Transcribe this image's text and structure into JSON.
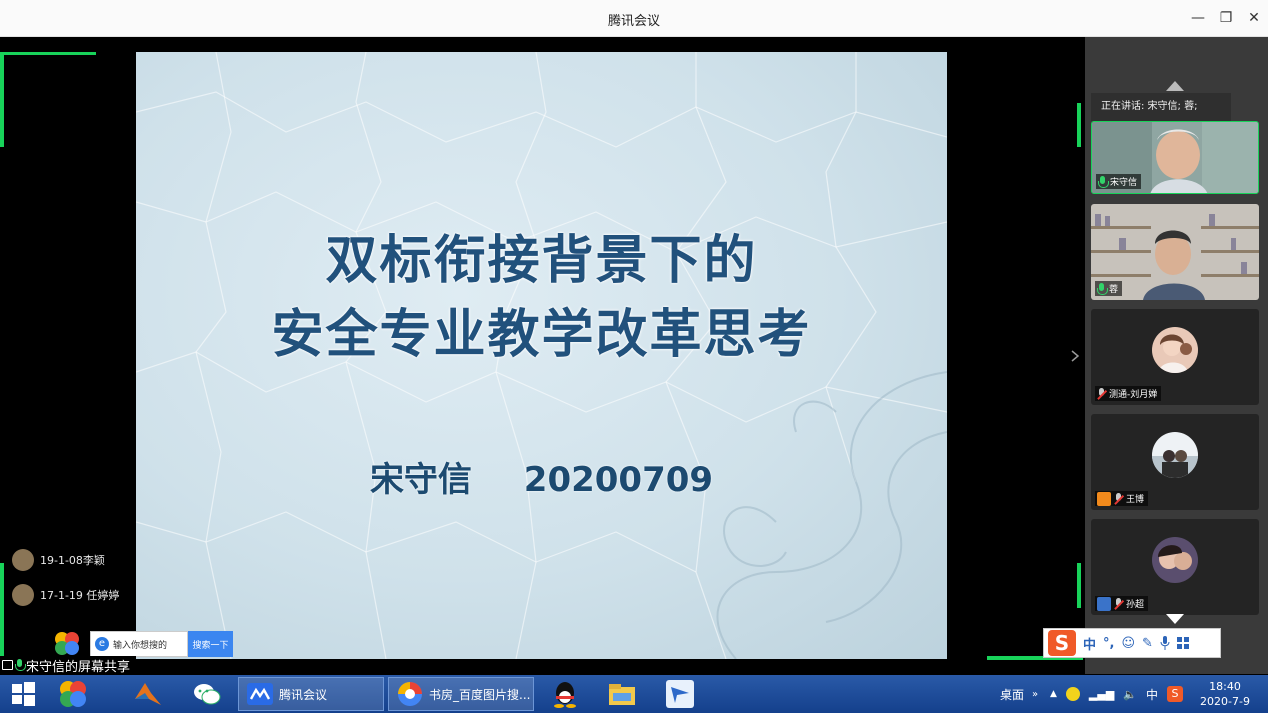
{
  "window": {
    "title": "腾讯会议",
    "minimize_icon": "minimize-icon",
    "restore_icon": "restore-icon",
    "close_icon": "close-icon"
  },
  "slide": {
    "title_line1": "双标衔接背景下的",
    "title_line2": "安全专业教学改革思考",
    "author": "宋守信",
    "date": "20200709"
  },
  "chat": [
    {
      "text": "19-1-08李颖"
    },
    {
      "text": "17-1-19 任婷婷"
    }
  ],
  "search": {
    "placeholder": "输入你想搜的",
    "button": "搜索一下"
  },
  "share_label": "宋守信的屏幕共享",
  "panel": {
    "speaking": "正在讲话: 宋守信; 蓉;",
    "participants": [
      {
        "name": "宋守信",
        "mic": "on"
      },
      {
        "name": "蓉",
        "mic": "on"
      },
      {
        "name": "测通-刘月婵",
        "mic": "muted"
      },
      {
        "name": "王博",
        "mic": "muted"
      },
      {
        "name": "孙超",
        "mic": "muted"
      }
    ]
  },
  "ime": {
    "mode": "中",
    "punct": "°,"
  },
  "taskbar": {
    "tasks": [
      {
        "label": "腾讯会议",
        "icon": "tencent-meeting-icon"
      },
      {
        "label": "书房_百度图片搜...",
        "icon": "browser-icon"
      }
    ],
    "desktop_label": "桌面",
    "ime_indicator": "中",
    "time": "18:40",
    "date": "2020-7-9"
  },
  "colors": {
    "accent_green": "#18d35a",
    "slide_text": "#21517c",
    "taskbar": "#1d4c9a"
  }
}
